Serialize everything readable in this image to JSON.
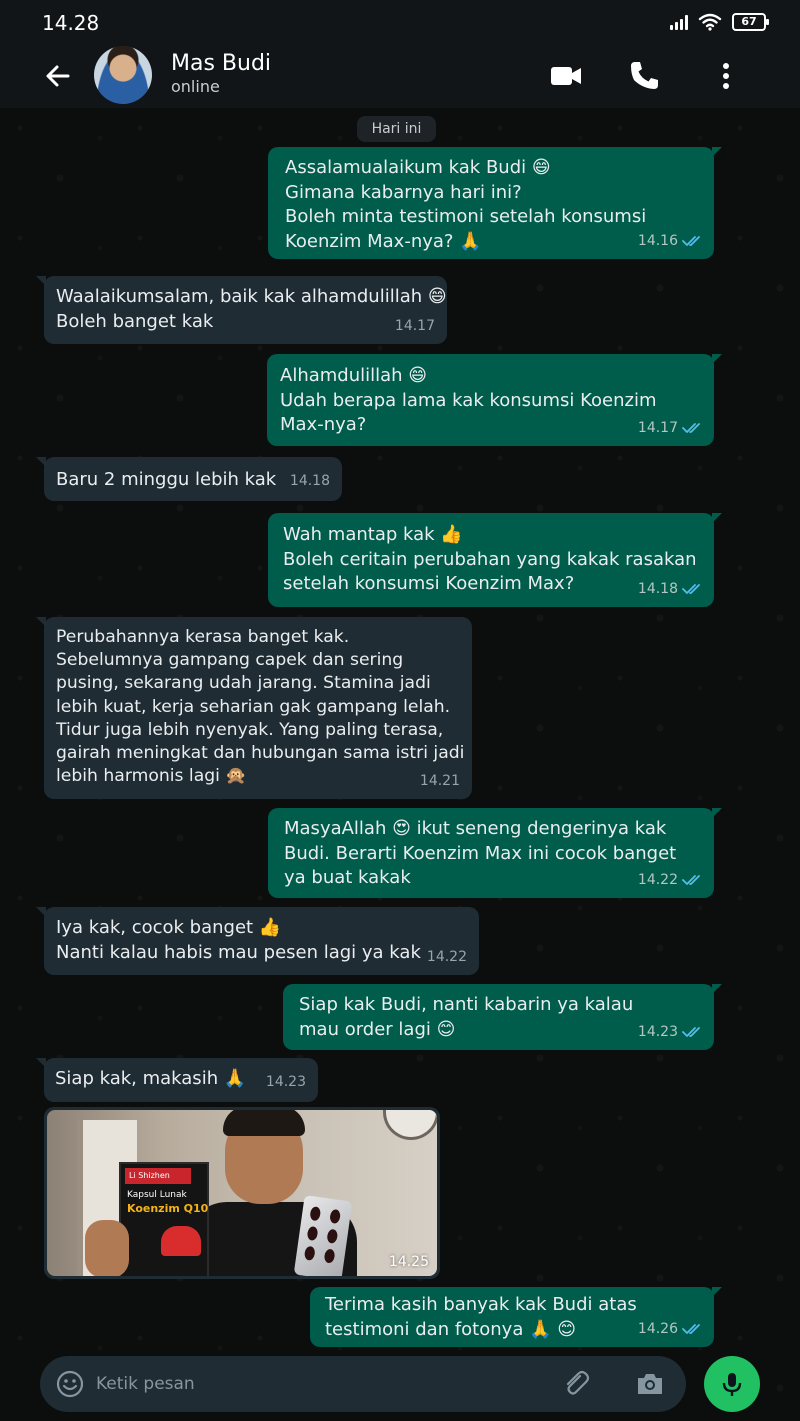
{
  "status_bar": {
    "time": "14.28",
    "battery": "67"
  },
  "header": {
    "contact_name": "Mas Budi",
    "contact_status": "online"
  },
  "date_chip": "Hari ini",
  "messages": [
    {
      "dir": "out",
      "text": "Assalamualaikum kak Budi 😄\nGimana kabarnya hari ini?\nBoleh minta testimoni setelah konsumsi\nKoenzim Max-nya? 🙏",
      "time": "14.16",
      "read": true
    },
    {
      "dir": "in",
      "text": "Waalaikumsalam, baik kak alhamdulillah 😄\nBoleh banget kak",
      "time": "14.17"
    },
    {
      "dir": "out",
      "text": "Alhamdulillah 😄\nUdah berapa lama kak konsumsi Koenzim\nMax-nya?",
      "time": "14.17",
      "read": true
    },
    {
      "dir": "in",
      "text": "Baru 2 minggu lebih kak",
      "time": "14.18"
    },
    {
      "dir": "out",
      "text": "Wah mantap kak 👍\nBoleh ceritain perubahan yang kakak rasakan\nsetelah konsumsi Koenzim Max?",
      "time": "14.18",
      "read": true
    },
    {
      "dir": "in",
      "text": "Perubahannya kerasa banget kak.\nSebelumnya gampang capek dan sering\npusing, sekarang udah jarang. Stamina jadi\nlebih kuat, kerja seharian gak gampang lelah.\nTidur juga lebih nyenyak. Yang paling terasa,\ngairah meningkat dan hubungan sama istri jadi\nlebih harmonis lagi 🙊",
      "time": "14.21"
    },
    {
      "dir": "out",
      "text": "MasyaAllah 😍 ikut seneng dengerinya kak\nBudi. Berarti Koenzim Max ini cocok banget\nya buat kakak",
      "time": "14.22",
      "read": true
    },
    {
      "dir": "in",
      "text": "Iya kak, cocok banget 👍\nNanti kalau habis mau pesen lagi ya kak",
      "time": "14.22"
    },
    {
      "dir": "out",
      "text": "Siap kak Budi, nanti kabarin ya kalau\nmau order lagi 😊",
      "time": "14.23",
      "read": true
    },
    {
      "dir": "in",
      "text": "Siap kak, makasih 🙏",
      "time": "14.23"
    },
    {
      "dir": "in",
      "type": "photo",
      "time": "14.25",
      "product": {
        "brand": "Li Shizhen",
        "line1": "Kapsul Lunak",
        "line2": "Koenzim Q10"
      }
    },
    {
      "dir": "out",
      "text": "Terima kasih banyak kak Budi atas\ntestimoni dan fotonya 🙏 😊",
      "time": "14.26",
      "read": true
    }
  ],
  "composer": {
    "placeholder": "Ketik pesan"
  },
  "colors": {
    "bubble_out": "#005c4b",
    "bubble_in": "#1f2c33",
    "read_tick": "#53bdeb",
    "mic_button": "#21c063",
    "header_bg": "#111517"
  }
}
